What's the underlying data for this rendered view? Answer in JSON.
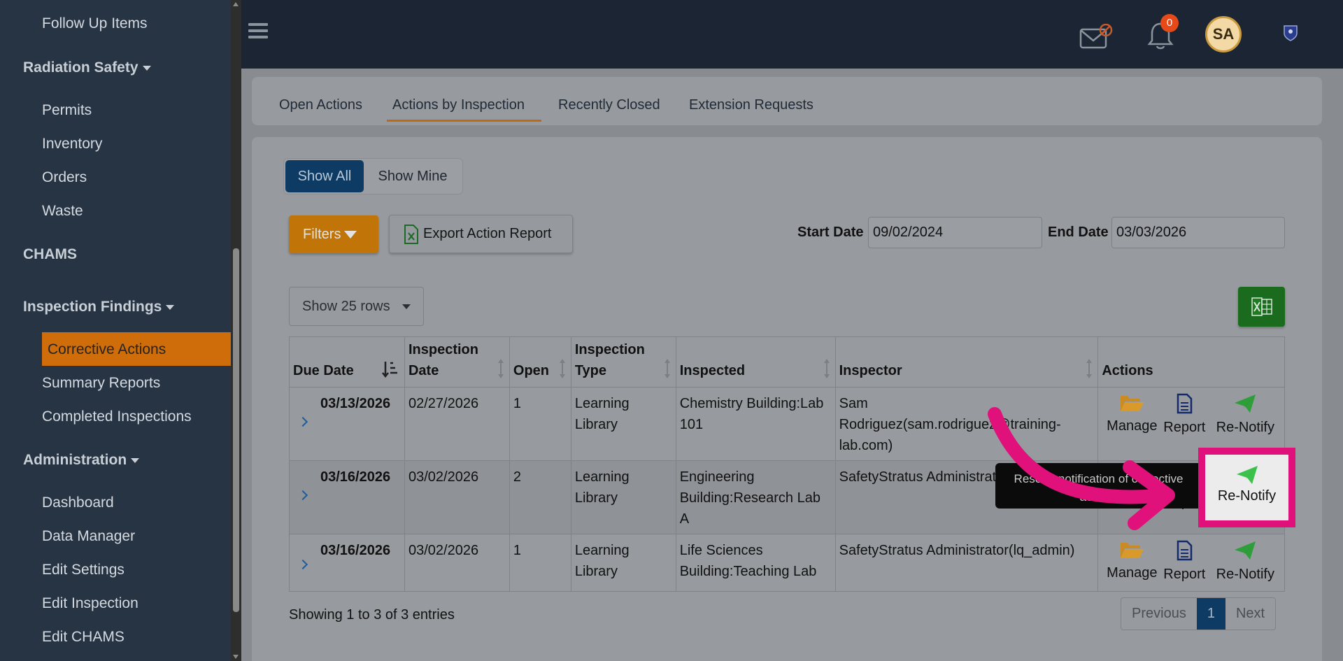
{
  "sidebar": {
    "items_top": [
      "Follow Up Items"
    ],
    "radiation_safety": {
      "label": "Radiation Safety",
      "items": [
        "Permits",
        "Inventory",
        "Orders",
        "Waste"
      ]
    },
    "chams": "CHAMS",
    "inspection_findings": {
      "label": "Inspection Findings",
      "active": "Corrective Actions",
      "items": [
        "Summary Reports",
        "Completed Inspections"
      ]
    },
    "administration": {
      "label": "Administration",
      "items": [
        "Dashboard",
        "Data Manager",
        "Edit Settings",
        "Edit Inspection",
        "Edit CHAMS"
      ]
    }
  },
  "topbar": {
    "notification_count": "0",
    "avatar_initials": "SA"
  },
  "tabs": [
    "Open Actions",
    "Actions by Inspection",
    "Recently Closed",
    "Extension Requests"
  ],
  "active_tab": "Actions by Inspection",
  "toggle": {
    "all": "Show All",
    "mine": "Show Mine"
  },
  "buttons": {
    "filters": "Filters",
    "export": "Export Action Report"
  },
  "dates": {
    "start_label": "Start Date",
    "start_value": "09/02/2024",
    "end_label": "End Date",
    "end_value": "03/03/2026"
  },
  "rows_select": "Show 25 rows",
  "table": {
    "headers": [
      "Due Date",
      "Inspection Date",
      "Open",
      "Inspection Type",
      "Inspected",
      "Inspector",
      "Actions"
    ],
    "rows": [
      {
        "due": "03/13/2026",
        "inspection_date": "02/27/2026",
        "open": "1",
        "type": "Learning Library",
        "inspected": "Chemistry Building:Lab 101",
        "inspector": "Sam Rodriguez(sam.rodriguez@training-lab.com)"
      },
      {
        "due": "03/16/2026",
        "inspection_date": "03/02/2026",
        "open": "2",
        "type": "Learning Library",
        "inspected": "Engineering Building:Research Lab A",
        "inspector": "SafetyStratus Administrator(lq_admin)"
      },
      {
        "due": "03/16/2026",
        "inspection_date": "03/02/2026",
        "open": "1",
        "type": "Learning Library",
        "inspected": "Life Sciences Building:Teaching Lab",
        "inspector": "SafetyStratus Administrator(lq_admin)"
      }
    ],
    "actions": {
      "manage": "Manage",
      "report": "Report",
      "renotify": "Re-Notify"
    }
  },
  "footer": {
    "info": "Showing 1 to 3 of 3 entries",
    "prev": "Previous",
    "page": "1",
    "next": "Next"
  },
  "tooltip": "Resend notification of corrective actions",
  "colors": {
    "sidebar": "#263444",
    "accent_orange": "#ce6d0a",
    "primary_blue": "#0d3b63",
    "highlight": "#e0117a",
    "renotify_green": "#2e9e3a"
  }
}
